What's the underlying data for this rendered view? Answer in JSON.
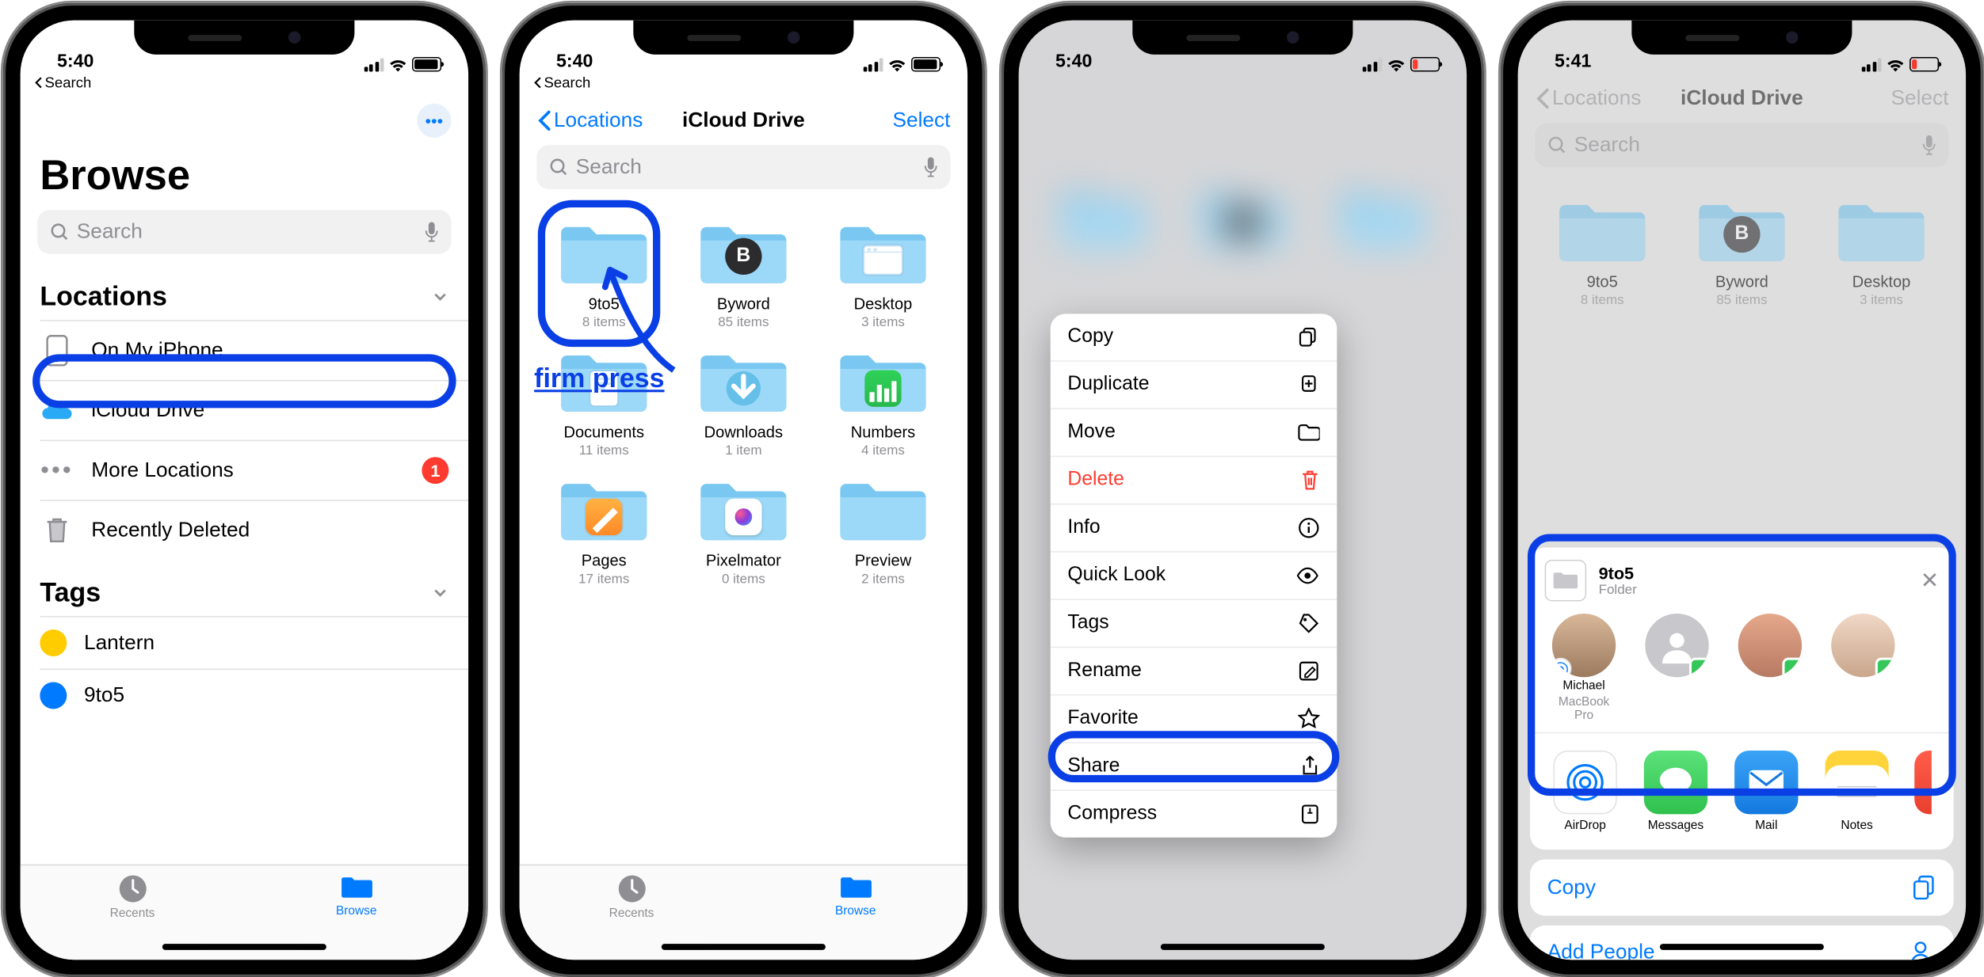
{
  "status": {
    "time1": "5:40",
    "time4": "5:41",
    "back": "Search"
  },
  "browse": {
    "title": "Browse",
    "search_placeholder": "Search",
    "sections": {
      "locations": "Locations",
      "tags": "Tags"
    },
    "loc_on_iphone": "On My iPhone",
    "loc_icloud": "iCloud Drive",
    "loc_more": "More Locations",
    "loc_more_badge": "1",
    "loc_deleted": "Recently Deleted",
    "tag_lantern": "Lantern",
    "tag_9to5": "9to5",
    "tabs": {
      "recents": "Recents",
      "browse": "Browse"
    }
  },
  "drive": {
    "back": "Locations",
    "title": "iCloud Drive",
    "select": "Select",
    "folders": [
      {
        "name": "9to5",
        "meta": "8 items"
      },
      {
        "name": "Byword",
        "meta": "85 items"
      },
      {
        "name": "Desktop",
        "meta": "3 items"
      },
      {
        "name": "Documents",
        "meta": "11 items"
      },
      {
        "name": "Downloads",
        "meta": "1 item"
      },
      {
        "name": "Numbers",
        "meta": "4 items"
      },
      {
        "name": "Pages",
        "meta": "17 items"
      },
      {
        "name": "Pixelmator",
        "meta": "0 items"
      },
      {
        "name": "Preview",
        "meta": "2 items"
      }
    ],
    "firm_press": "firm press"
  },
  "menu": {
    "copy": "Copy",
    "duplicate": "Duplicate",
    "move": "Move",
    "delete": "Delete",
    "info": "Info",
    "quicklook": "Quick Look",
    "tags": "Tags",
    "rename": "Rename",
    "favorite": "Favorite",
    "share": "Share",
    "compress": "Compress"
  },
  "share": {
    "item_name": "9to5",
    "item_kind": "Folder",
    "people": [
      {
        "name": "Michael",
        "sub": "MacBook Pro"
      },
      {
        "name": ""
      },
      {
        "name": ""
      },
      {
        "name": ""
      }
    ],
    "apps": [
      {
        "name": "AirDrop"
      },
      {
        "name": "Messages"
      },
      {
        "name": "Mail"
      },
      {
        "name": "Notes"
      }
    ],
    "copy": "Copy",
    "add_people": "Add People"
  }
}
